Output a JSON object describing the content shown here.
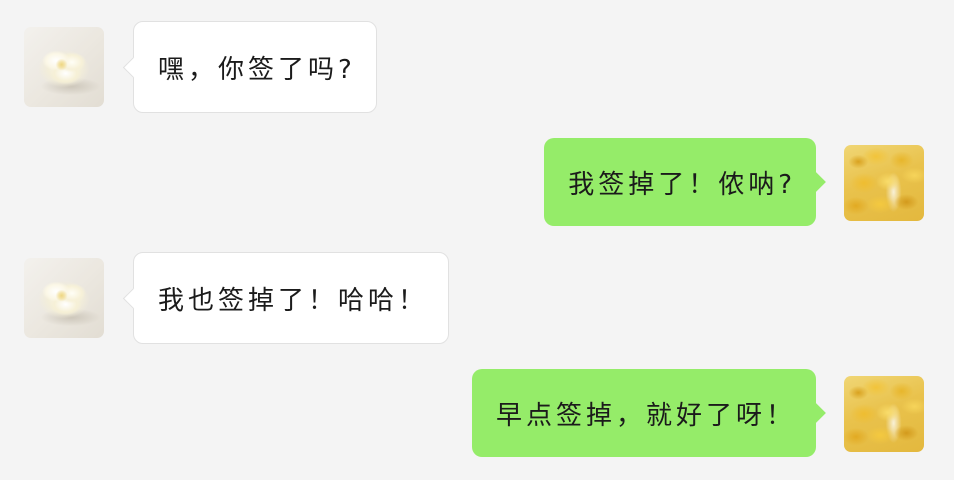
{
  "chat": {
    "messages": [
      {
        "side": "incoming",
        "text": "嘿，你签了吗?",
        "avatar_icon": "white-flower-avatar"
      },
      {
        "side": "outgoing",
        "text": "我签掉了！侬呐?",
        "avatar_icon": "ginkgo-leaves-avatar"
      },
      {
        "side": "incoming",
        "text": "我也签掉了！哈哈！",
        "avatar_icon": "white-flower-avatar"
      },
      {
        "side": "outgoing",
        "text": "早点签掉，就好了呀！",
        "avatar_icon": "ginkgo-leaves-avatar"
      }
    ]
  },
  "colors": {
    "background": "#f4f4f4",
    "incoming_bubble": "#ffffff",
    "incoming_border": "#e1e1e1",
    "outgoing_bubble": "#95ec69",
    "text": "#1b1b1b"
  }
}
